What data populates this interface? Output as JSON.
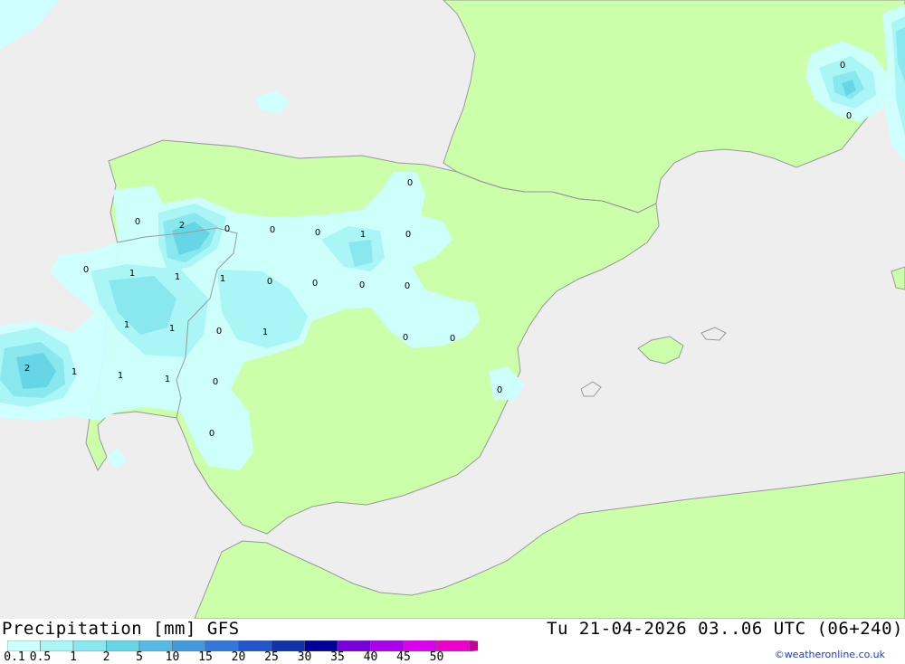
{
  "title": "Precipitation [mm] GFS",
  "datetime": "Tu 21-04-2026 03..06 UTC (06+240)",
  "credit": "©weatheronline.co.uk",
  "colors": {
    "sea": "#eeeeee",
    "land": "#ccffaa",
    "coast": "#999999"
  },
  "legend": {
    "colors": [
      "#ccffff",
      "#aaf5f5",
      "#88e8ee",
      "#66d6e6",
      "#55bbe6",
      "#4499dd",
      "#3377dd",
      "#2255cc",
      "#1133aa",
      "#000099",
      "#7700dd",
      "#aa00ee",
      "#dd00ee",
      "#ee00cc",
      "#cc0099"
    ],
    "labels": [
      "0.1",
      "0.5",
      "1",
      "2",
      "5",
      "10",
      "15",
      "20",
      "25",
      "30",
      "35",
      "40",
      "45",
      "50"
    ]
  },
  "values": [
    "0",
    "0",
    "2",
    "0",
    "0",
    "0",
    "1",
    "0",
    "0",
    "1",
    "1",
    "1",
    "0",
    "0",
    "0",
    "0",
    "1",
    "1",
    "0",
    "1",
    "0",
    "0",
    "2",
    "1",
    "1",
    "1",
    "0",
    "0",
    "0",
    "0",
    "0"
  ]
}
